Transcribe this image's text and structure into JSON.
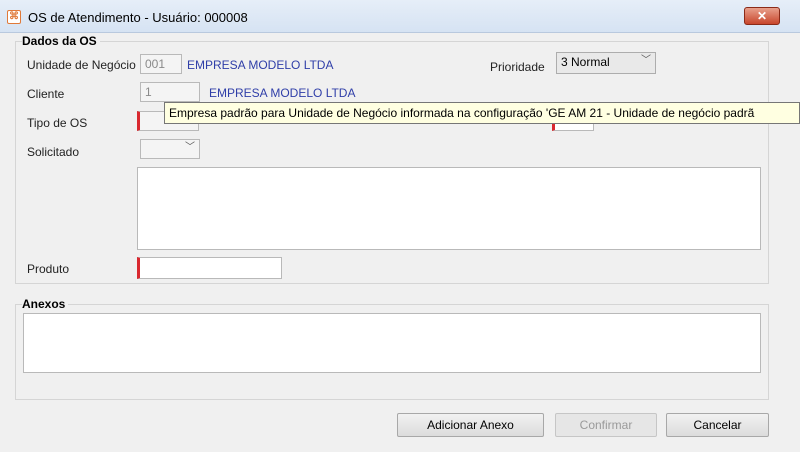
{
  "window": {
    "title": "OS de Atendimento - Usuário: 000008",
    "close_label": "✕"
  },
  "dados": {
    "group_title": "Dados da OS",
    "unidade_label": "Unidade de Negócio",
    "unidade_code": "001",
    "unidade_name": "EMPRESA MODELO LTDA",
    "prioridade_label": "Prioridade",
    "prioridade_value": "3 Normal",
    "cliente_label": "Cliente",
    "cliente_code": "1",
    "cliente_name": "EMPRESA MODELO LTDA",
    "tipo_label": "Tipo de OS",
    "solicitado_label": "Solicitado",
    "produto_label": "Produto"
  },
  "tooltip": "Empresa padrão para Unidade de Negócio informada na configuração 'GE AM 21 - Unidade de negócio padrã",
  "anexos": {
    "group_title": "Anexos"
  },
  "buttons": {
    "adicionar": "Adicionar Anexo",
    "confirmar": "Confirmar",
    "cancelar": "Cancelar"
  }
}
